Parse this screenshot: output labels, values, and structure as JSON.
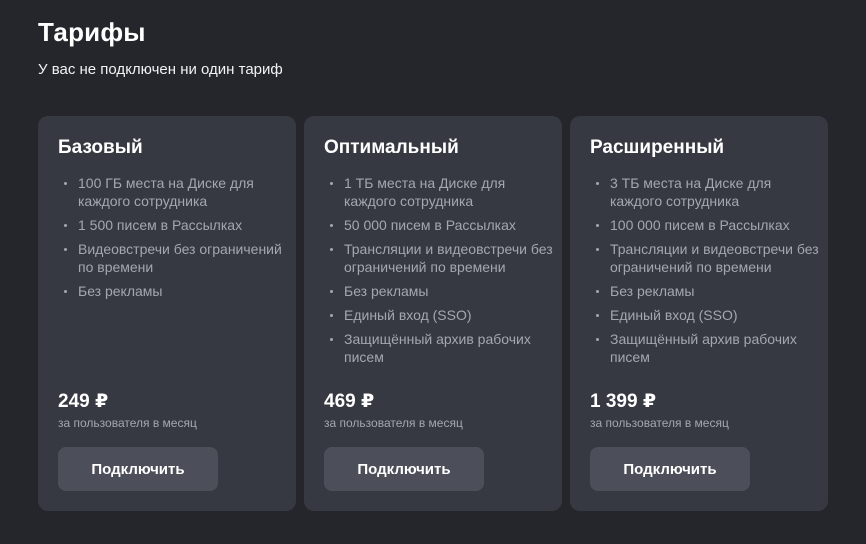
{
  "header": {
    "title": "Тарифы",
    "subtitle": "У вас не подключен ни один тариф"
  },
  "plans": [
    {
      "name": "Базовый",
      "features": [
        "100 ГБ места на Диске для каждого сотрудника",
        "1 500 писем в Рассылках",
        "Видеовстречи без ограничений по времени",
        "Без рекламы"
      ],
      "price": "249 ₽",
      "period": "за пользователя в месяц",
      "button_label": "Подключить"
    },
    {
      "name": "Оптимальный",
      "features": [
        "1 ТБ места на Диске для каждого сотрудника",
        "50 000 писем в Рассылках",
        "Трансляции и видеовстречи без ограничений по времени",
        "Без рекламы",
        "Единый вход (SSO)",
        "Защищённый архив рабочих писем"
      ],
      "price": "469 ₽",
      "period": "за пользователя в месяц",
      "button_label": "Подключить"
    },
    {
      "name": "Расширенный",
      "features": [
        "3 ТБ места на Диске для каждого сотрудника",
        "100 000 писем в Рассылках",
        "Трансляции и видеовстречи без ограничений по времени",
        "Без рекламы",
        "Единый вход (SSO)",
        "Защищённый архив рабочих писем"
      ],
      "price": "1 399 ₽",
      "period": "за пользователя в месяц",
      "button_label": "Подключить"
    }
  ]
}
